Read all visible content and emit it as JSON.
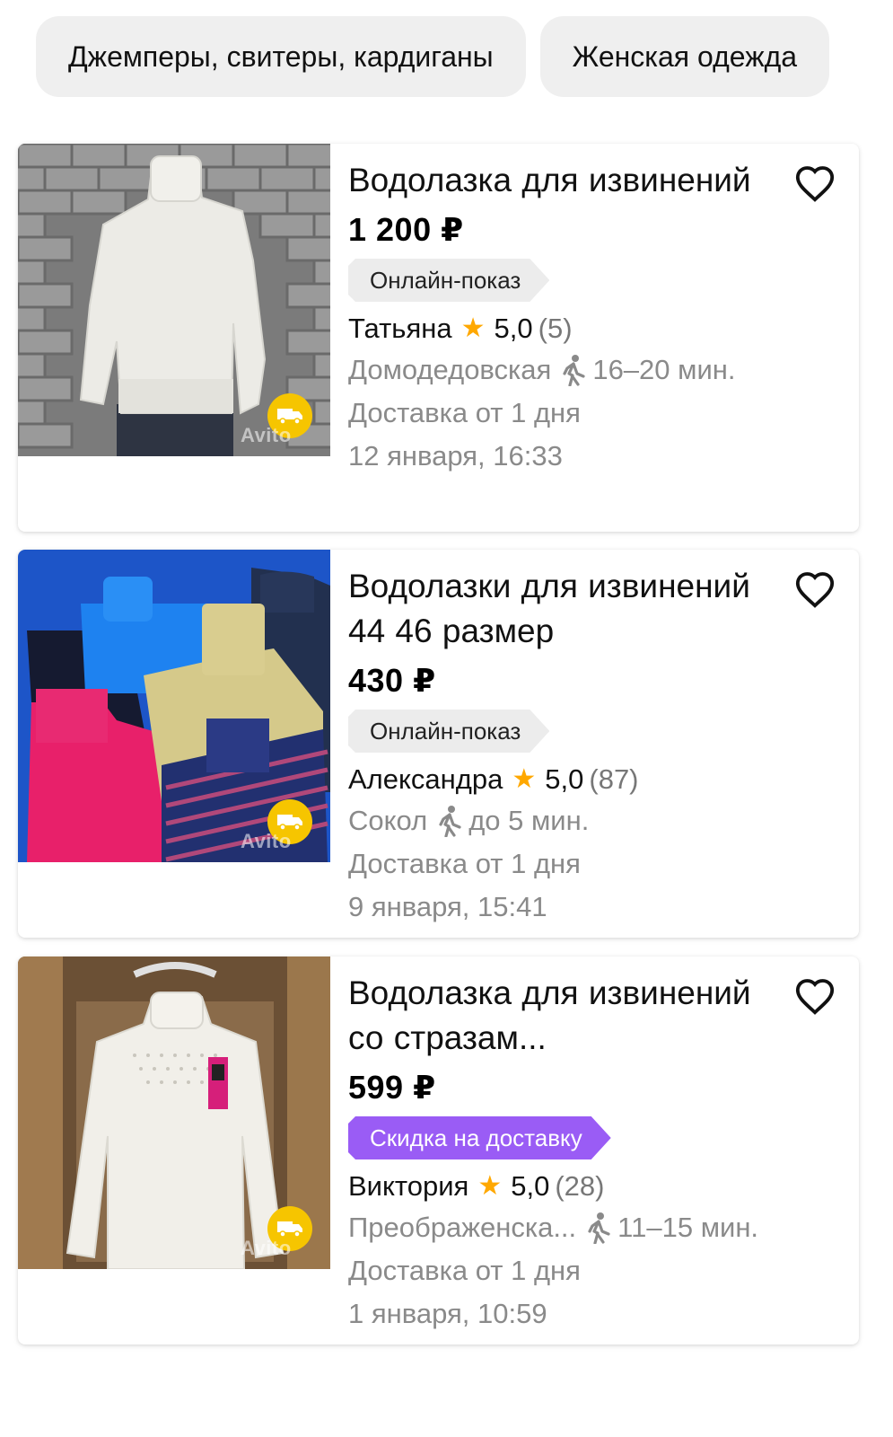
{
  "chips": [
    "Джемперы, свитеры, кардиганы",
    "Женская одежда"
  ],
  "watermark": "Avito",
  "listings": [
    {
      "title": "Водолазка для извинений",
      "price": "1 200 ₽",
      "tag": "Онлайн-показ",
      "seller": "Татьяна",
      "rating": "5,0",
      "reviews": "(5)",
      "metro": "Домодедовская",
      "walk": "16–20 мин.",
      "delivery": "Доставка от 1 дня",
      "date": "12 января, 16:33"
    },
    {
      "title": "Водолазки для извинений 44 46 размер",
      "price": "430 ₽",
      "tag": "Онлайн-показ",
      "seller": "Александра",
      "rating": "5,0",
      "reviews": "(87)",
      "metro": "Сокол",
      "walk": "до 5 мин.",
      "delivery": "Доставка от 1 дня",
      "date": "9 января, 15:41"
    },
    {
      "title": "Водолазка для извинений со стразам...",
      "price": "599 ₽",
      "tag": "Скидка на доставку",
      "seller": "Виктория",
      "rating": "5,0",
      "reviews": "(28)",
      "metro": "Преображенска...",
      "walk": "11–15 мин.",
      "delivery": "Доставка от 1 дня",
      "date": "1 января, 10:59"
    }
  ],
  "colors": {
    "star": "#ffa800",
    "promo_tag": "#9a5cf5",
    "delivery_badge": "#f6c500",
    "muted_text": "#8a8a8a"
  }
}
